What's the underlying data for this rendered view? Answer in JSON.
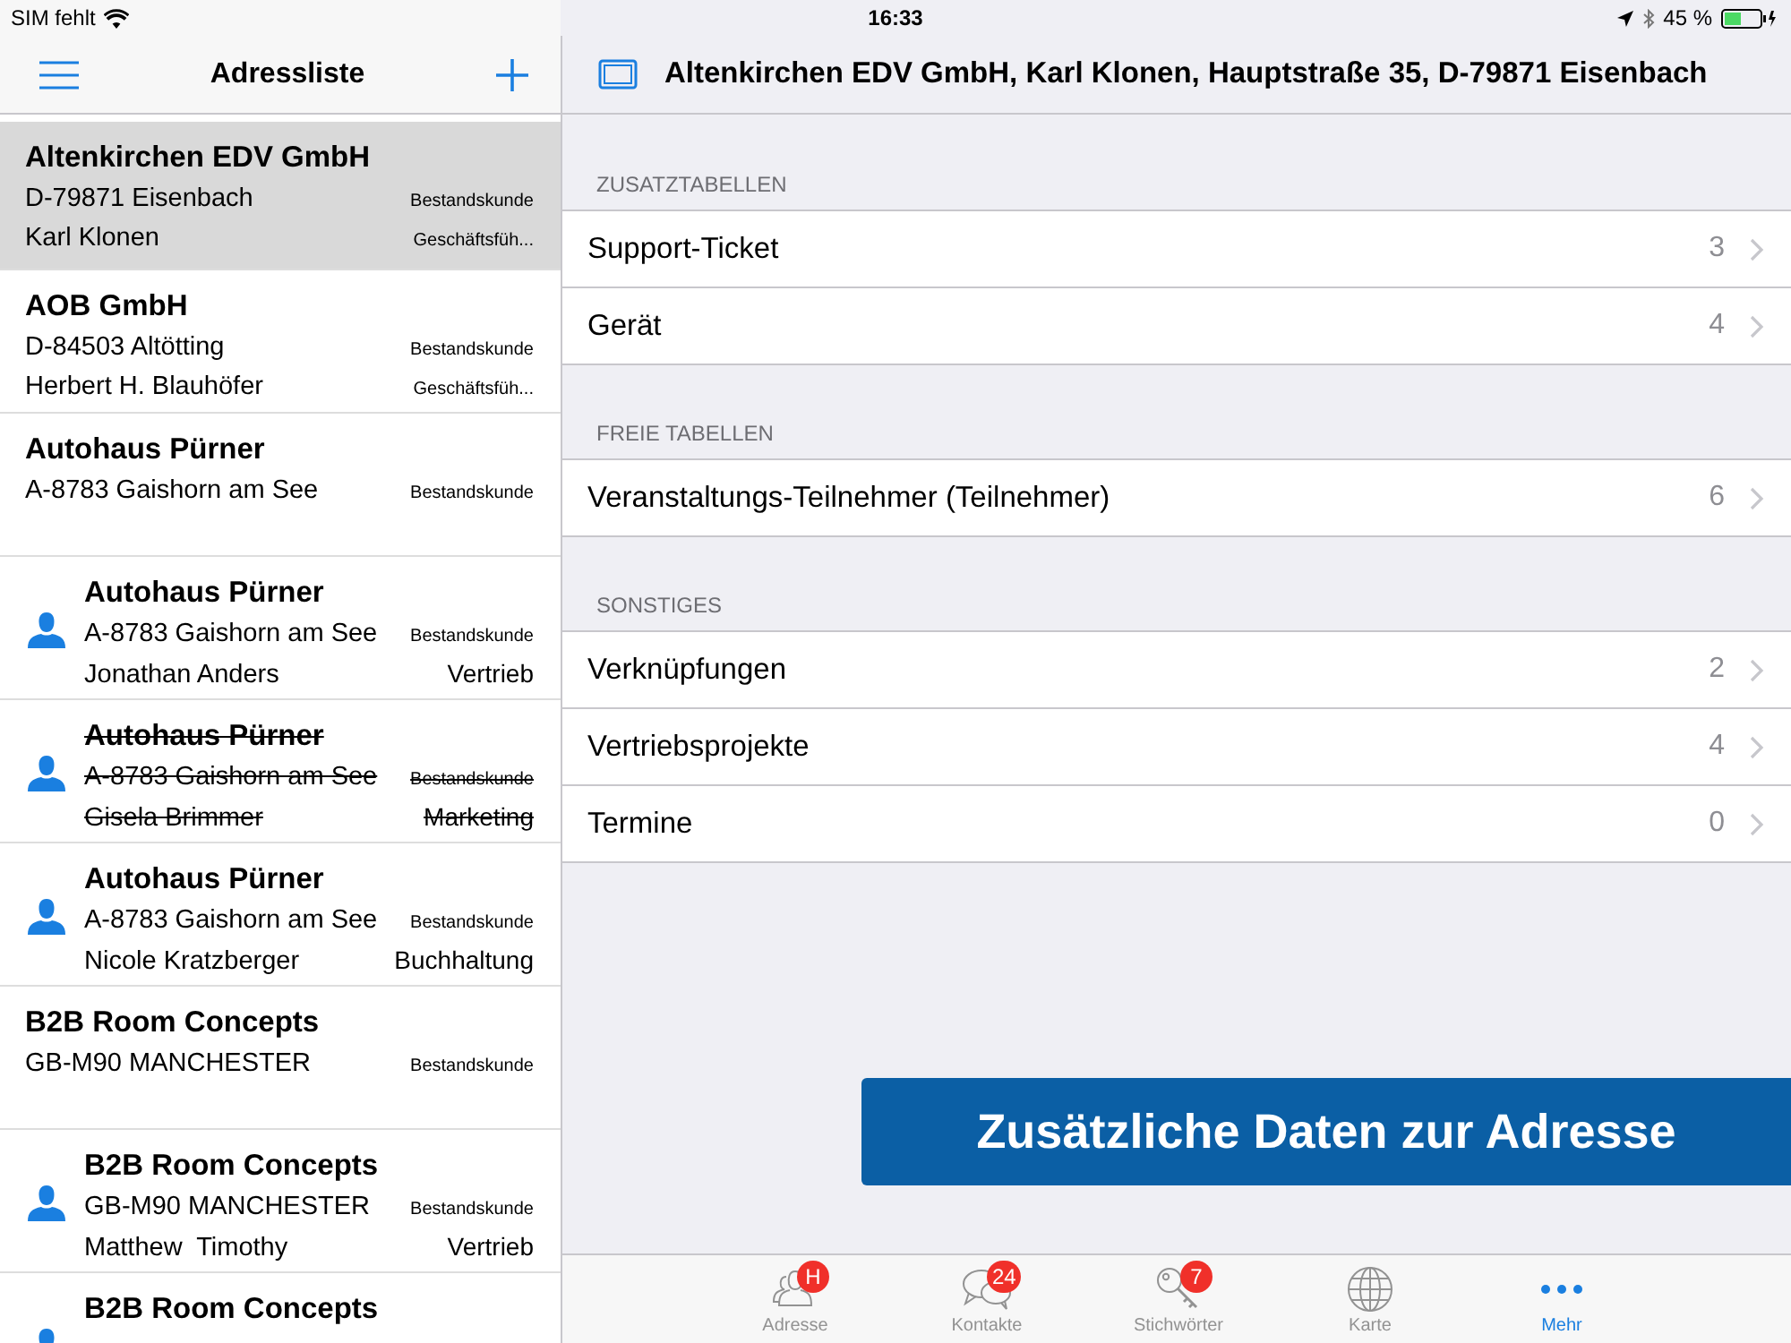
{
  "status_bar": {
    "carrier": "SIM fehlt",
    "time": "16:33",
    "battery": "45 %"
  },
  "sidebar": {
    "title": "Adressliste",
    "items": [
      {
        "kind": "company",
        "name": "Altenkirchen EDV GmbH",
        "line_2": "D-79871 Eisenbach",
        "line_3": "Karl Klonen",
        "status": "Bestandskunde",
        "role": "Geschäftsfüh...",
        "selected": true,
        "deleted": false
      },
      {
        "kind": "company",
        "name": "AOB GmbH",
        "line_2": "D-84503 Altötting",
        "line_3": "Herbert H. Blauhöfer",
        "status": "Bestandskunde",
        "role": "Geschäftsfüh...",
        "selected": false,
        "deleted": false
      },
      {
        "kind": "company",
        "name": "Autohaus Pürner",
        "line_2": "A-8783 Gaishorn am See",
        "status": "Bestandskunde",
        "selected": false,
        "deleted": false
      },
      {
        "kind": "contact",
        "name": "Autohaus Pürner",
        "line_2": "A-8783 Gaishorn am See",
        "line_3": "Jonathan Anders",
        "status": "Bestandskunde",
        "role": "Vertrieb",
        "selected": false,
        "deleted": false
      },
      {
        "kind": "contact",
        "name": "Autohaus Pürner",
        "line_2": "A-8783 Gaishorn am See",
        "line_3": "Gisela Brimmer",
        "status": "Bestandskunde",
        "role": "Marketing",
        "selected": false,
        "deleted": true
      },
      {
        "kind": "contact",
        "name": "Autohaus Pürner",
        "line_2": "A-8783 Gaishorn am See",
        "line_3": "Nicole Kratzberger",
        "status": "Bestandskunde",
        "role": "Buchhaltung",
        "selected": false,
        "deleted": false
      },
      {
        "kind": "company",
        "name": "B2B Room Concepts",
        "line_2": "GB-M90 MANCHESTER",
        "status": "Bestandskunde",
        "selected": false,
        "deleted": false
      },
      {
        "kind": "contact",
        "name": "B2B Room Concepts",
        "line_2": "GB-M90 MANCHESTER",
        "line_3": "Matthew  Timothy",
        "status": "Bestandskunde",
        "role": "Vertrieb",
        "selected": false,
        "deleted": false
      },
      {
        "kind": "contact",
        "name": "B2B Room Concepts",
        "selected": false,
        "deleted": false
      }
    ]
  },
  "detail": {
    "title": "Altenkirchen EDV GmbH, Karl Klonen, Hauptstraße 35, D-79871 Eisenbach",
    "sections": [
      {
        "heading": "ZUSATZTABELLEN",
        "rows": [
          {
            "label": "Support-Ticket",
            "count": "3"
          },
          {
            "label": "Gerät",
            "count": "4"
          }
        ]
      },
      {
        "heading": "FREIE TABELLEN",
        "rows": [
          {
            "label": "Veranstaltungs-Teilnehmer (Teilnehmer)",
            "count": "6"
          }
        ]
      },
      {
        "heading": "SONSTIGES",
        "rows": [
          {
            "label": "Verknüpfungen",
            "count": "2"
          },
          {
            "label": "Vertriebsprojekte",
            "count": "4"
          },
          {
            "label": "Termine",
            "count": "0"
          }
        ]
      }
    ],
    "banner": "Zusätzliche Daten zur Adresse"
  },
  "tab_bar": [
    {
      "kind": "people",
      "label": "Adresse",
      "badge": "H",
      "selected": false
    },
    {
      "kind": "chat",
      "label": "Kontakte",
      "badge": "24",
      "selected": false
    },
    {
      "kind": "key",
      "label": "Stichwörter",
      "badge": "7",
      "selected": false
    },
    {
      "kind": "globe",
      "label": "Karte",
      "selected": false
    },
    {
      "kind": "more",
      "label": "Mehr",
      "selected": true
    }
  ]
}
